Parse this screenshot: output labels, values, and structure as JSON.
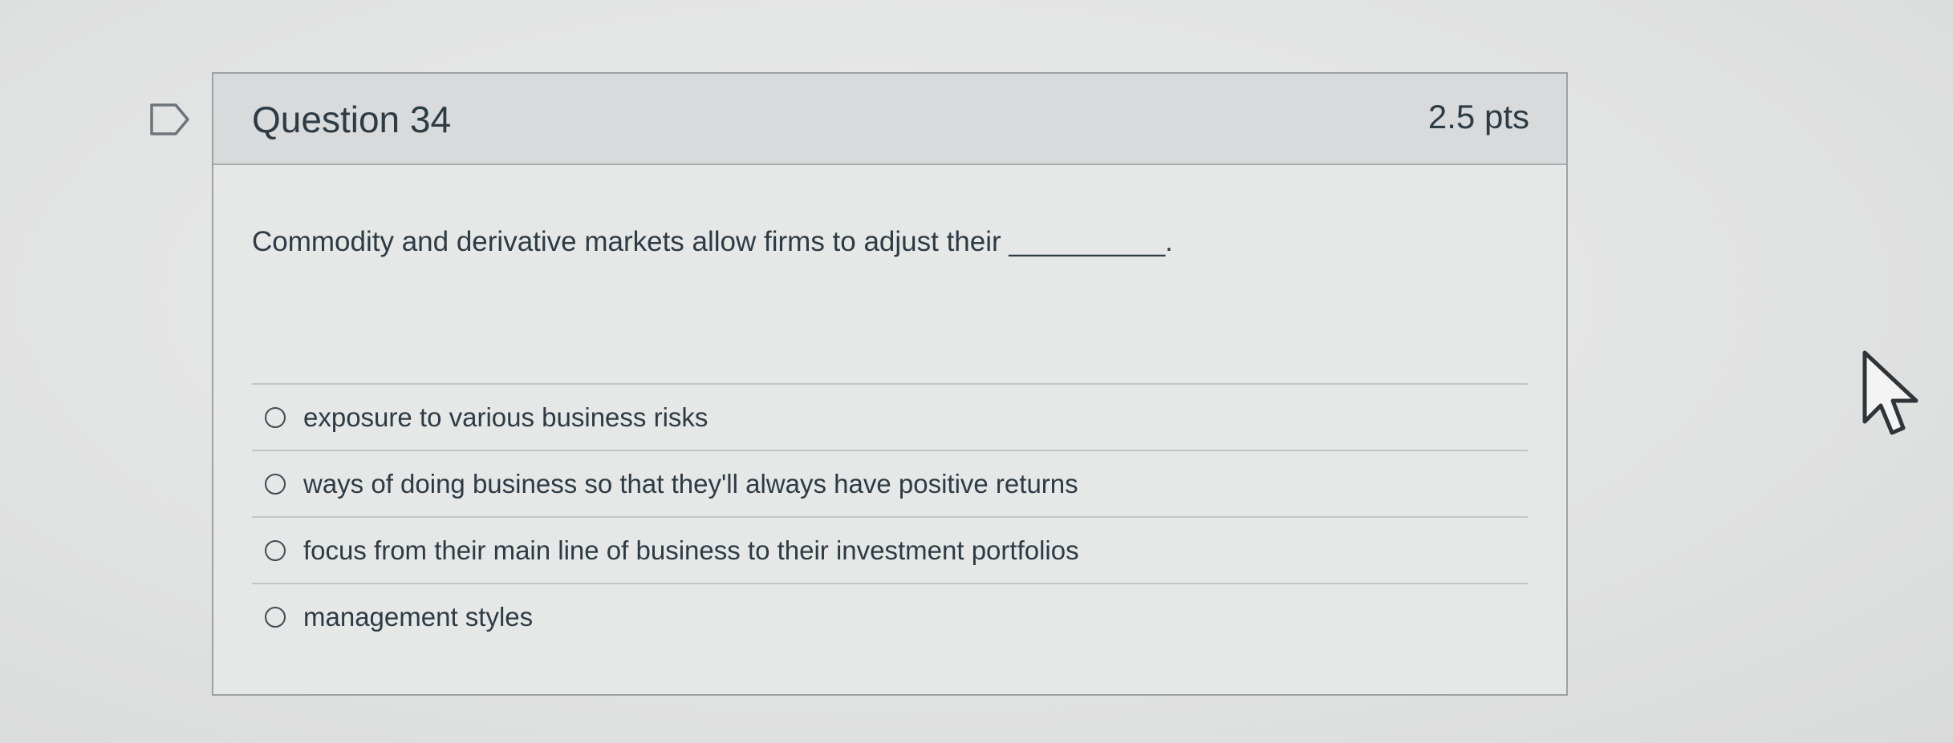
{
  "question": {
    "title": "Question 34",
    "points": "2.5 pts",
    "text": "Commodity and derivative markets allow firms to adjust their __________.",
    "flag_icon": "flag-question-icon"
  },
  "answers": [
    {
      "label": "exposure to various business risks",
      "selected": false
    },
    {
      "label": "ways of doing business so that they'll always have positive returns",
      "selected": false
    },
    {
      "label": "focus from their main line of business to their investment portfolios",
      "selected": false
    },
    {
      "label": "management styles",
      "selected": false
    }
  ],
  "cursor_icon": "mouse-pointer-icon"
}
